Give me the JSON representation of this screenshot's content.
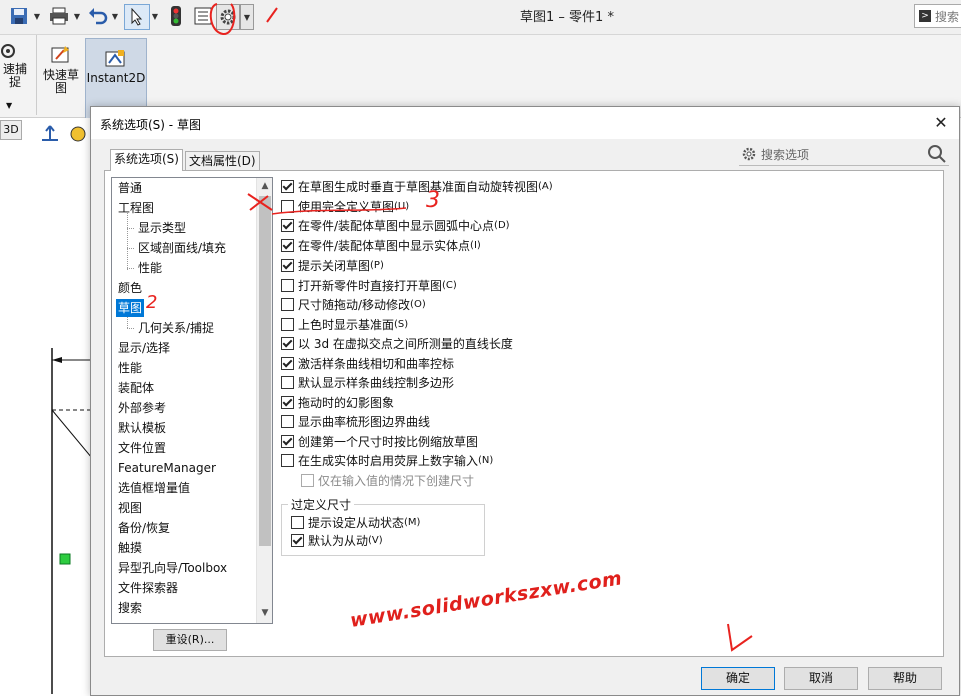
{
  "toolbar": {
    "doc_title": "草图1 – 零件1 *",
    "search_label": "搜索"
  },
  "ribbon": {
    "quick_snap_label": "速捕\n捉",
    "quick_sketch_label": "快速草\n图",
    "instant2d_label": "Instant2D"
  },
  "left_strip": {
    "view3d_label": "3D"
  },
  "dialog": {
    "title": "系统选项(S) - 草图",
    "close_glyph": "✕",
    "tabs": [
      {
        "label": "系统选项(S)"
      },
      {
        "label": "文档属性(D)"
      }
    ],
    "search_placeholder": "搜索选项",
    "tree_items": [
      {
        "label": "普通"
      },
      {
        "label": "工程图"
      },
      {
        "label": "显示类型"
      },
      {
        "label": "区域剖面线/填充"
      },
      {
        "label": "性能"
      },
      {
        "label": "颜色"
      },
      {
        "label": "草图"
      },
      {
        "label": "几何关系/捕捉"
      },
      {
        "label": "显示/选择"
      },
      {
        "label": "性能"
      },
      {
        "label": "装配体"
      },
      {
        "label": "外部参考"
      },
      {
        "label": "默认模板"
      },
      {
        "label": "文件位置"
      },
      {
        "label": "FeatureManager"
      },
      {
        "label": "选值框增量值"
      },
      {
        "label": "视图"
      },
      {
        "label": "备份/恢复"
      },
      {
        "label": "触摸"
      },
      {
        "label": "异型孔向导/Toolbox"
      },
      {
        "label": "文件探索器"
      },
      {
        "label": "搜索"
      }
    ],
    "reset_label": "重设(R)...",
    "options": [
      {
        "label": "在草图生成时垂直于草图基准面自动旋转视图",
        "shortcut": "(A)",
        "checked": true
      },
      {
        "label": "使用完全定义草图",
        "shortcut": "(U)",
        "checked": false
      },
      {
        "label": "在零件/装配体草图中显示圆弧中心点",
        "shortcut": "(D)",
        "checked": true
      },
      {
        "label": "在零件/装配体草图中显示实体点",
        "shortcut": "(I)",
        "checked": true
      },
      {
        "label": "提示关闭草图",
        "shortcut": "(P)",
        "checked": true
      },
      {
        "label": "打开新零件时直接打开草图",
        "shortcut": "(C)",
        "checked": false
      },
      {
        "label": "尺寸随拖动/移动修改",
        "shortcut": "(O)",
        "checked": false
      },
      {
        "label": "上色时显示基准面",
        "shortcut": "(S)",
        "checked": false
      },
      {
        "label": "以 3d 在虚拟交点之间所测量的直线长度",
        "shortcut": "",
        "checked": true
      },
      {
        "label": "激活样条曲线相切和曲率控标",
        "shortcut": "",
        "checked": true
      },
      {
        "label": "默认显示样条曲线控制多边形",
        "shortcut": "",
        "checked": false
      },
      {
        "label": "拖动时的幻影图象",
        "shortcut": "",
        "checked": true
      },
      {
        "label": "显示曲率梳形图边界曲线",
        "shortcut": "",
        "checked": false
      },
      {
        "label": "创建第一个尺寸时按比例缩放草图",
        "shortcut": "",
        "checked": true
      },
      {
        "label": "在生成实体时启用荧屏上数字输入",
        "shortcut": "(N)",
        "checked": false
      },
      {
        "label": "仅在输入值的情况下创建尺寸",
        "shortcut": "",
        "checked": false,
        "disabled": true
      }
    ],
    "overdefined_group": {
      "legend": "过定义尺寸",
      "options": [
        {
          "label": "提示设定从动状态",
          "shortcut": "(M)",
          "checked": false
        },
        {
          "label": "默认为从动",
          "shortcut": "(V)",
          "checked": true
        }
      ]
    },
    "buttons": {
      "ok": "确定",
      "cancel": "取消",
      "help": "帮助"
    }
  },
  "annotations": {
    "mark_1": "1",
    "mark_2": "2",
    "mark_3": "3",
    "watermark": "www.solidworkszxw.com"
  },
  "colors": {
    "selection": "#0078d7",
    "annotation_red": "#e8231f"
  }
}
